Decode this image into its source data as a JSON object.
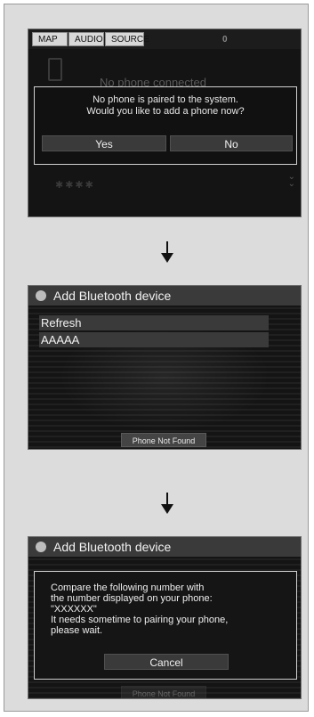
{
  "screens": [
    {
      "tabs": [
        "MAP",
        "AUDIO",
        "SOURCE"
      ],
      "top_number": "0",
      "bg_status": "No phone connected",
      "dialog_lines": [
        "No phone is paired to the system.",
        "Would you like to add a phone now?"
      ],
      "buttons": {
        "yes": "Yes",
        "no": "No"
      },
      "bottom_stars": "✱✱✱✱"
    },
    {
      "header_title": "Add Bluetooth device",
      "list_items": [
        "Refresh",
        "AAAAA"
      ],
      "bottom_button": "Phone Not Found"
    },
    {
      "header_title": "Add Bluetooth device",
      "compare_lines": [
        "Compare the following number with",
        "the number displayed on your phone:",
        "\"XXXXXX\"",
        "It needs sometime to pairing your phone,",
        "please wait."
      ],
      "cancel": "Cancel",
      "bottom_button": "Phone Not Found"
    }
  ]
}
